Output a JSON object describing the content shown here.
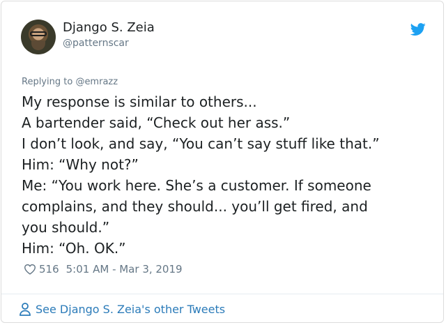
{
  "user": {
    "display_name": "Django S. Zeia",
    "handle": "@patternscar"
  },
  "reply": {
    "prefix": "Replying to ",
    "mention": "@emrazz"
  },
  "tweet": {
    "lines": [
      "My response is similar to others...",
      "A bartender said, “Check out her ass.”",
      "I don’t look, and say, “You can’t say stuff like that.”",
      "Him: “Why not?”",
      "Me: “You work here. She’s a customer. If someone",
      "complains, and they should... you’ll get fired, and",
      "you should.”",
      "Him: “Oh. OK.”"
    ]
  },
  "meta": {
    "likes": "516",
    "timestamp": "5:01 AM - Mar 3, 2019"
  },
  "footer": {
    "see_more": "See Django S. Zeia's other Tweets"
  },
  "colors": {
    "twitter_blue": "#1da1f2",
    "link_blue": "#2b7bb9",
    "muted_gray": "#657786",
    "text_dark": "#1c2022"
  },
  "icons": {
    "brand": "twitter-bird-icon",
    "like": "heart-icon",
    "profile": "person-icon"
  }
}
